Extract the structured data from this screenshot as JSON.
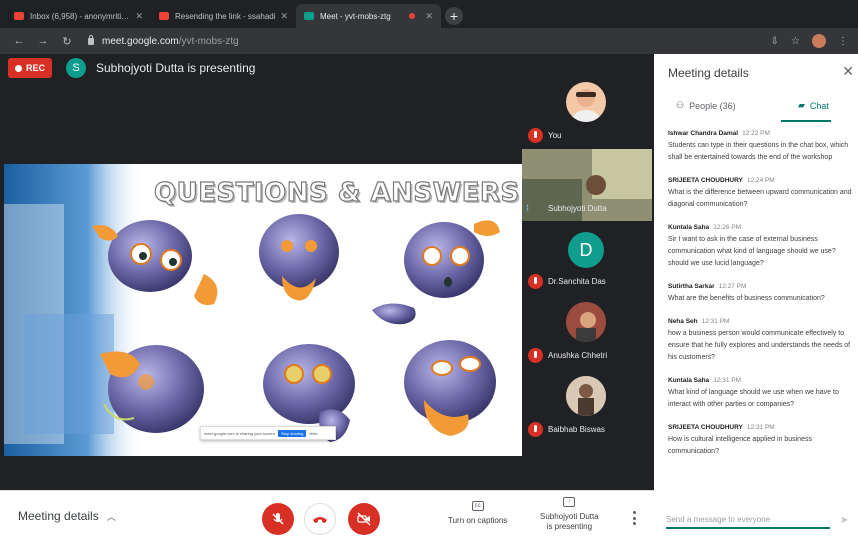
{
  "browser": {
    "tabs": [
      {
        "title": "Inbox (6,958) - anonymritikudi",
        "favicon_color": "#ea4335",
        "recording": false
      },
      {
        "title": "Resending the link - ssahadi",
        "favicon_color": "#ea4335",
        "recording": false
      },
      {
        "title": "Meet - yvt-mobs-ztg",
        "favicon_color": "#0f9d8d",
        "recording": true
      }
    ],
    "address": {
      "host": "meet.google.com",
      "path": "/yvt-mobs-ztg"
    }
  },
  "meet": {
    "rec_label": "REC",
    "presenter": {
      "initial": "S",
      "text": "Subhojyoti Dutta is presenting"
    },
    "slide": {
      "title": "QUESTIONS & ANSWERS",
      "share_bar": {
        "text": "meet.google.com is sharing your screen",
        "stop": "Stop sharing",
        "hide": "Hide"
      }
    },
    "participants": [
      {
        "name": "You",
        "muted": true,
        "kind": "photo"
      },
      {
        "name": "Subhojyoti Dutta",
        "muted": false,
        "kind": "video"
      },
      {
        "name": "Dr.Sanchita Das",
        "muted": true,
        "kind": "letter",
        "initial": "D"
      },
      {
        "name": "Anushka Chhetri",
        "muted": true,
        "kind": "photo"
      },
      {
        "name": "Baibhab Biswas",
        "muted": true,
        "kind": "photo"
      }
    ],
    "bottom": {
      "meeting_details": "Meeting details",
      "captions": "Turn on captions",
      "presenting_line1": "Subhojyoti Dutta",
      "presenting_line2": "is presenting"
    }
  },
  "panel": {
    "title": "Meeting details",
    "people_tab": "People (36)",
    "chat_tab": "Chat",
    "messages": [
      {
        "sender": "Ishwar Chandra Damal",
        "time": "12:22 PM",
        "text": "Students can type in their questions in the chat box, which shall be entertained towards the end of the workshop"
      },
      {
        "sender": "SRIJEETA CHOUDHURY",
        "time": "12:24 PM",
        "text": "What is the difference between upward communication and diagonal communication?"
      },
      {
        "sender": "Kuntala Saha",
        "time": "12:26 PM",
        "text": "Sir I want to ask in the case of external business communication what kind of language should we use? should we use lucid language?"
      },
      {
        "sender": "Sutirtha Sarkar",
        "time": "12:27 PM",
        "text": "What are the benefits of business communication?"
      },
      {
        "sender": "Neha Seh",
        "time": "12:31 PM",
        "text": "how a business person would communicate effectively to ensure that he fully explores and understands the needs of his customers?"
      },
      {
        "sender": "Kuntala Saha",
        "time": "12:31 PM",
        "text": "What kind of language should we use when we have to interact with other parties or companies?"
      },
      {
        "sender": "SRIJEETA CHOUDHURY",
        "time": "12:31 PM",
        "text": "How is cultural intelligence applied in business communication?"
      }
    ],
    "composer_placeholder": "Send a message to everyone"
  }
}
